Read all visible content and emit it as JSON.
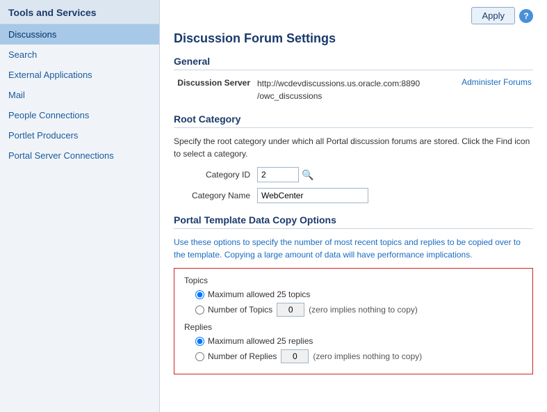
{
  "sidebar": {
    "title": "Tools and Services",
    "items": [
      {
        "id": "discussions",
        "label": "Discussions",
        "active": true
      },
      {
        "id": "search",
        "label": "Search",
        "active": false
      },
      {
        "id": "external-applications",
        "label": "External Applications",
        "active": false
      },
      {
        "id": "mail",
        "label": "Mail",
        "active": false
      },
      {
        "id": "people-connections",
        "label": "People Connections",
        "active": false
      },
      {
        "id": "portlet-producers",
        "label": "Portlet Producers",
        "active": false
      },
      {
        "id": "portal-server-connections",
        "label": "Portal Server Connections",
        "active": false
      }
    ]
  },
  "header": {
    "apply_label": "Apply",
    "help_icon": "?"
  },
  "page": {
    "title": "Discussion Forum Settings"
  },
  "general": {
    "section_title": "General",
    "server_label": "Discussion Server",
    "server_value_line1": "http://wcdevdiscussions.us.oracle.com:8890",
    "server_value_line2": "/owc_discussions",
    "administer_link": "Administer Forums"
  },
  "root_category": {
    "section_title": "Root Category",
    "description": "Specify the root category under which all Portal discussion forums are stored. Click the Find icon to select a category.",
    "category_id_label": "Category ID",
    "category_id_value": "2",
    "category_name_label": "Category Name",
    "category_name_value": "WebCenter",
    "search_icon": "🔍"
  },
  "portal_template": {
    "section_title": "Portal Template Data Copy Options",
    "description": "Use these options to specify the number of most recent topics and replies to be copied over to the template. Copying a large amount of data will have performance implications.",
    "topics_group": "Topics",
    "topics_max_label": "Maximum allowed 25 topics",
    "topics_number_label": "Number of Topics",
    "topics_number_value": "0",
    "topics_zero_note": "(zero implies nothing to copy)",
    "replies_group": "Replies",
    "replies_max_label": "Maximum allowed 25 replies",
    "replies_number_label": "Number of Replies",
    "replies_number_value": "0",
    "replies_zero_note": "(zero implies nothing to copy)"
  }
}
